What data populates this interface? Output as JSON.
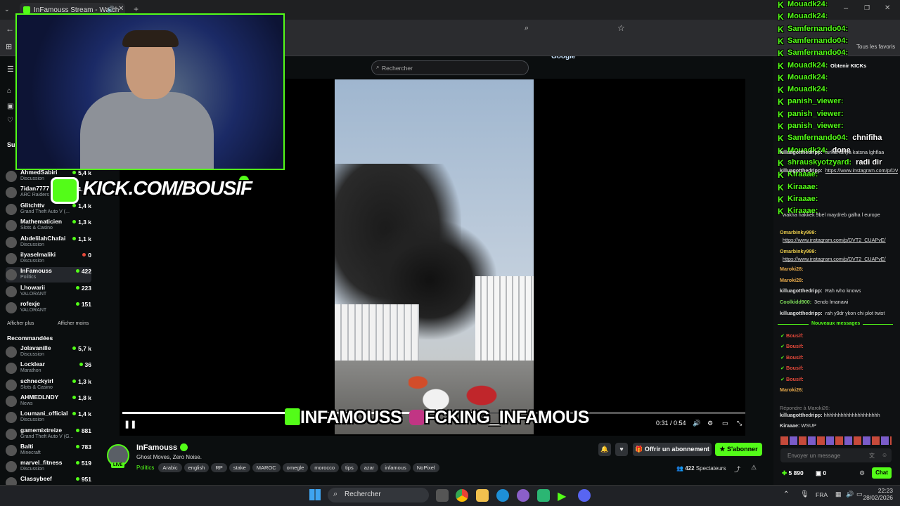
{
  "browser": {
    "tab_title": "InFamouss Stream - Watch",
    "ask_google": "Demander à Google",
    "bookmarks_label": "Tous les favoris"
  },
  "kick": {
    "search_placeholder": "Rechercher",
    "followed_title": "Suivi",
    "followed": [
      {
        "name": "AhmedSabiri",
        "category": "Discussion",
        "viewers": "5,4 k"
      },
      {
        "name": "7idan7777",
        "category": "ARC Raiders",
        "viewers": "1,4 k"
      },
      {
        "name": "Glitchttv",
        "category": "Grand Theft Auto V (...",
        "viewers": "1,4 k"
      },
      {
        "name": "Mathematicien",
        "category": "Slots & Casino",
        "viewers": "1,3 k"
      },
      {
        "name": "AbdelilahChafai",
        "category": "Discussion",
        "viewers": "1,1 k"
      },
      {
        "name": "ilyaselmaliki",
        "category": "Discussion",
        "viewers": "0"
      },
      {
        "name": "InFamouss",
        "category": "Politics",
        "viewers": "422"
      },
      {
        "name": "Lhowarii",
        "category": "VALORANT",
        "viewers": "223"
      },
      {
        "name": "rofexje",
        "category": "VALORANT",
        "viewers": "151"
      }
    ],
    "show_more": "Afficher plus",
    "show_less": "Afficher moins",
    "recommended_title": "Recommandées",
    "recommended": [
      {
        "name": "Jolavanille",
        "category": "Discussion",
        "viewers": "5,7 k"
      },
      {
        "name": "Locklear",
        "category": "Marathon",
        "viewers": "36"
      },
      {
        "name": "schneckyirl",
        "category": "Slots & Casino",
        "viewers": "1,3 k"
      },
      {
        "name": "AHMEDLNDY",
        "category": "News",
        "viewers": "1,8 k"
      },
      {
        "name": "Loumani_official",
        "category": "Discussion",
        "viewers": "1,4 k"
      },
      {
        "name": "gamemixtreize",
        "category": "Grand Theft Auto V (G...",
        "viewers": "881"
      },
      {
        "name": "Balti",
        "category": "Minecraft",
        "viewers": "783"
      },
      {
        "name": "marvel_fitness",
        "category": "Discussion",
        "viewers": "519"
      },
      {
        "name": "Classybeef",
        "category": "",
        "viewers": "951"
      }
    ],
    "player": {
      "time": "0:31 / 0:54",
      "progress": 0.574,
      "overlay_handle_text": "INFAMOUSS",
      "overlay_ig_text": "FCKING_INFAMOUS",
      "overlay_kick_url": "KICK.COM/BOUSIF"
    },
    "stream": {
      "channel": "InFamouss",
      "title": "Ghost Moves, Zero Noise.",
      "category": "Politics",
      "tags": [
        "Arabic",
        "english",
        "RP",
        "stake",
        "MAROC",
        "omegle",
        "morocco",
        "tips",
        "azar",
        "infamous",
        "NoPixel"
      ],
      "live_badge": "LIVE",
      "subscribe_gift": "Offrir un abonnement",
      "subscribe": "S'abonner",
      "viewers": "422",
      "viewers_label": "Spectateurs"
    },
    "chat": {
      "get_kicks": "Obtenir KICKs",
      "overlay_msgs": [
        {
          "user": "Mouadk24:",
          "text": ""
        },
        {
          "user": "Mouadk24:",
          "text": ""
        },
        {
          "user": "Samfernando04:",
          "text": ""
        },
        {
          "user": "Samfernando04:",
          "text": ""
        },
        {
          "user": "Samfernando04:",
          "text": ""
        },
        {
          "user": "Mouadk24:",
          "text": ""
        },
        {
          "user": "Mouadk24:",
          "text": ""
        },
        {
          "user": "Mouadk24:",
          "text": ""
        },
        {
          "user": "panish_viewer:",
          "text": ""
        },
        {
          "user": "panish_viewer:",
          "text": ""
        },
        {
          "user": "panish_viewer:",
          "text": ""
        },
        {
          "user": "Samfernando04:",
          "text": "chnifiha"
        },
        {
          "user": "Mouadk24:",
          "text": "done"
        },
        {
          "user": "shrauskyotzyard:",
          "text": "radi dir"
        },
        {
          "user": "Kiraaae:",
          "text": ""
        },
        {
          "user": "Kiraaae:",
          "text": ""
        },
        {
          "user": "Kiraaae:",
          "text": ""
        },
        {
          "user": "Kiraaae:",
          "text": ""
        }
      ],
      "messages": [
        {
          "user": "killuagotthedripp:",
          "text": "turkia tahya katsna lghflaa"
        },
        {
          "user": "killuagotthedripp:",
          "text": "https://www.instagram.com/p/DVUMzklCP9Z/"
        },
        {
          "user": "",
          "text": "wakha hakkek 9bel maydreb galha l europe"
        },
        {
          "user": "Omarbinky999:",
          "text": ""
        },
        {
          "user": "",
          "text": "https://www.instagram.com/p/DVT2_CUAPvE/"
        },
        {
          "user": "Omarbinky999:",
          "text": ""
        },
        {
          "user": "",
          "text": "https://www.instagram.com/p/DVT2_CUAPvE/"
        },
        {
          "user": "Maroki28:",
          "text": ""
        },
        {
          "user": "Maroki28:",
          "text": ""
        },
        {
          "user": "killuagotthedripp:",
          "text": "Rah who knows"
        },
        {
          "user": "Coolkidd900:",
          "text": "3endo lmanawi"
        },
        {
          "user": "killuagotthedripp:",
          "text": "rah y9dr ykon chi plot twist"
        }
      ],
      "new_messages": "Nouveaux messages",
      "bousif_user": "Bousif:",
      "maroki_msg_user": "Maroki26:",
      "reply_hint": "Répondre à Maroki26:",
      "killua_last": "killuagotthedripp:",
      "killua_last_text": "hhhhhhhhhhhhhhhhhhhh",
      "kiraaae_user": "Kiraaae:",
      "kiraaae_text": "WSUP",
      "input_placeholder": "Envoyer un message",
      "kicks": "5 890",
      "zero": "0",
      "chat_button": "Chat"
    }
  },
  "taskbar": {
    "search": "Rechercher",
    "lang": "FRA",
    "time": "22:23",
    "date": "28/02/2026"
  },
  "colors": {
    "kick_green": "#53fc18",
    "live_red": "#e5493a"
  }
}
